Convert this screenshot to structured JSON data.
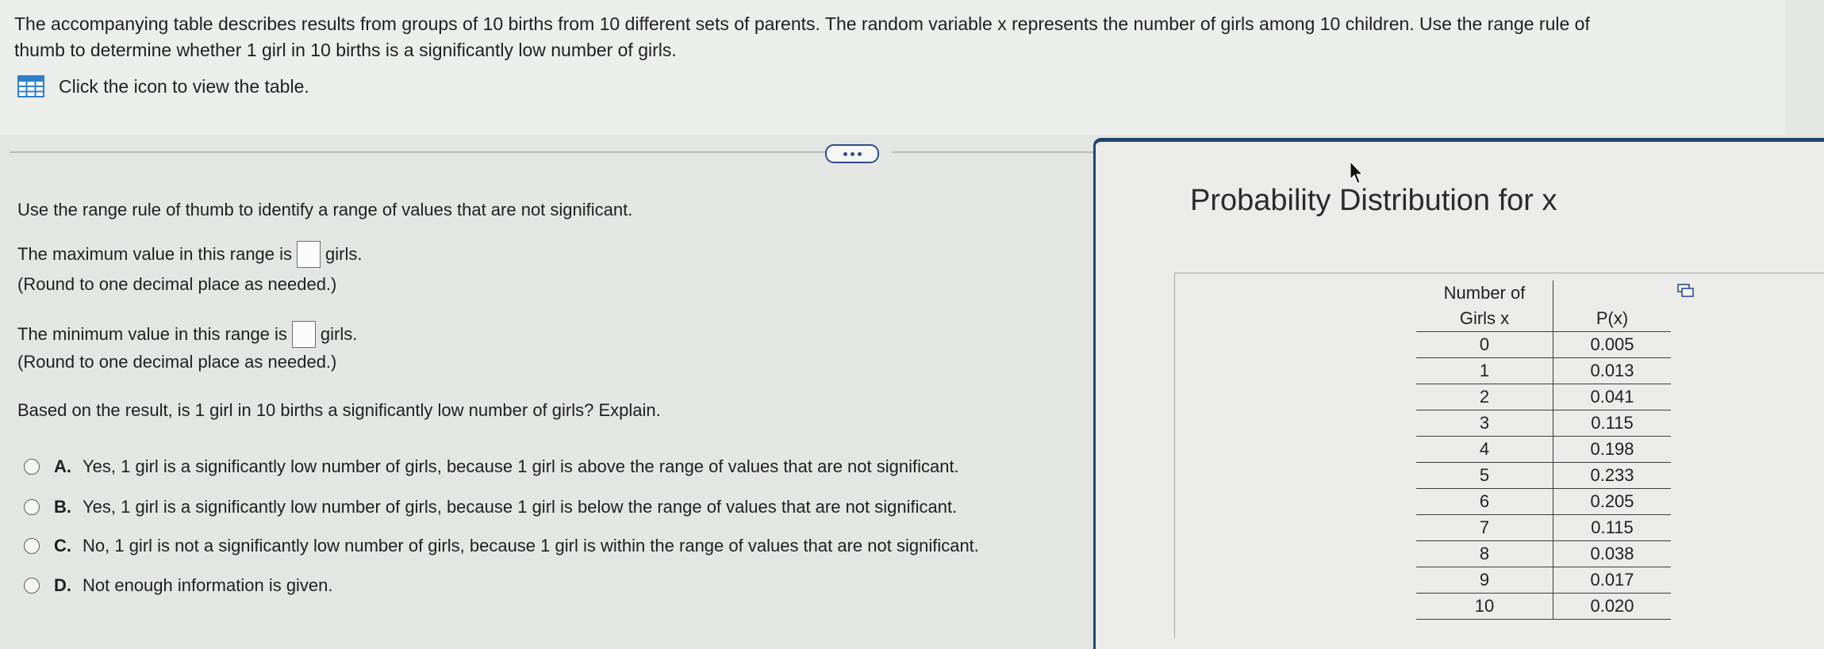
{
  "question": {
    "text_line1": "The accompanying table describes results from groups of 10 births from 10 different sets of parents. The random variable x represents the number of girls among 10 children. Use the range rule of",
    "text_line2": "thumb to determine whether 1 girl in 10 births is a significantly low number of girls.",
    "view_table_label": "Click the icon to view the table."
  },
  "part": {
    "instruction": "Use the range rule of thumb to identify a range of values that are not significant.",
    "max_prefix": "The maximum value in this range is",
    "max_suffix": "girls.",
    "max_value": "",
    "max_hint": "(Round to one decimal place as needed.)",
    "min_prefix": "The minimum value in this range is",
    "min_suffix": "girls.",
    "min_value": "",
    "min_hint": "(Round to one decimal place as needed.)",
    "explain_question": "Based on the result, is 1 girl in 10 births a significantly low number of girls? Explain."
  },
  "options": [
    {
      "letter": "A.",
      "text": "Yes, 1 girl is a significantly low number of girls, because 1 girl is above the range of values that are not significant."
    },
    {
      "letter": "B.",
      "text": "Yes, 1 girl is a significantly low number of girls, because 1 girl is below the range of values that are not significant."
    },
    {
      "letter": "C.",
      "text": "No, 1 girl is not a significantly low number of girls, because 1 girl is within the range of values that are not significant."
    },
    {
      "letter": "D.",
      "text": "Not enough information is given."
    }
  ],
  "panel": {
    "title": "Probability Distribution for x",
    "col1_header_line1": "Number of",
    "col1_header_line2": "Girls x",
    "col2_header": "P(x)",
    "rows": [
      {
        "x": "0",
        "p": "0.005"
      },
      {
        "x": "1",
        "p": "0.013"
      },
      {
        "x": "2",
        "p": "0.041"
      },
      {
        "x": "3",
        "p": "0.115"
      },
      {
        "x": "4",
        "p": "0.198"
      },
      {
        "x": "5",
        "p": "0.233"
      },
      {
        "x": "6",
        "p": "0.205"
      },
      {
        "x": "7",
        "p": "0.115"
      },
      {
        "x": "8",
        "p": "0.038"
      },
      {
        "x": "9",
        "p": "0.017"
      },
      {
        "x": "10",
        "p": "0.020"
      }
    ]
  },
  "colors": {
    "accent": "#2e4d8c",
    "panel_border": "#23456f",
    "table_icon": "#2f7fc8"
  },
  "icons": {
    "table_icon": "table-icon",
    "more_icon": "ellipsis-icon",
    "cursor_icon": "mouse-pointer-icon",
    "copy_icon": "copy-icon"
  }
}
